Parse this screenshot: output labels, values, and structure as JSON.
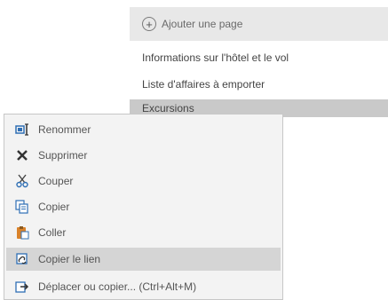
{
  "page_list": {
    "add_page_label": "Ajouter une page",
    "pages": [
      "Informations sur l'hôtel et le vol",
      "Liste d'affaires à emporter",
      "Excursions"
    ]
  },
  "context_menu": {
    "items": [
      {
        "label": "Renommer",
        "icon": "rename-icon"
      },
      {
        "label": "Supprimer",
        "icon": "delete-icon"
      },
      {
        "label": "Couper",
        "icon": "cut-icon"
      },
      {
        "label": "Copier",
        "icon": "copy-icon"
      },
      {
        "label": "Coller",
        "icon": "paste-icon"
      },
      {
        "label": "Copier le lien",
        "icon": "link-icon"
      },
      {
        "label": "Déplacer ou copier... (Ctrl+Alt+M)",
        "icon": "move-copy-icon"
      }
    ]
  },
  "colors": {
    "panel_header_bg": "#e8e8e8",
    "menu_bg": "#f3f3f3",
    "selected_bg": "#d5d5d5",
    "icon_blue": "#2f6fb5",
    "icon_orange": "#d9822b"
  }
}
